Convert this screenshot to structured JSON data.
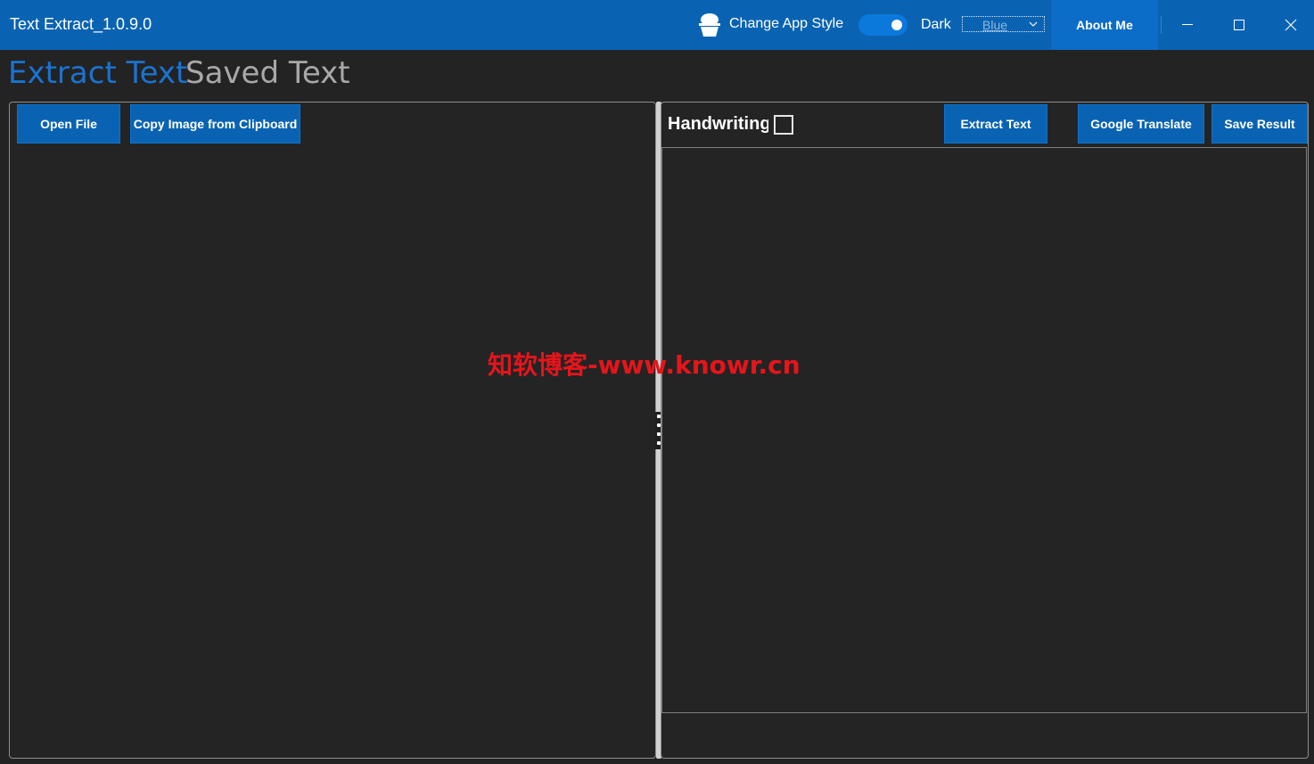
{
  "window": {
    "title": "Text Extract_1.0.9.0"
  },
  "header": {
    "style_label": "Change App Style",
    "theme_toggle": {
      "label": "Dark",
      "on": true
    },
    "color_select": {
      "value": "Blue"
    },
    "about_label": "About Me"
  },
  "tabs": {
    "extract": "Extract Text",
    "saved": "Saved Text",
    "active": "extract"
  },
  "left_panel": {
    "open_file_label": "Open File",
    "clipboard_label": "Copy Image from Clipboard"
  },
  "right_panel": {
    "handwriting_label": "Handwriting",
    "handwriting_checked": false,
    "extract_label": "Extract Text",
    "translate_label": "Google Translate",
    "save_label": "Save Result"
  },
  "watermark": "知软博客-www.knowr.cn",
  "colors": {
    "accent": "#0a63b2",
    "tab_active": "#1a73d1",
    "background": "#232323",
    "watermark": "#e5151b"
  },
  "icons": [
    "cupcake-icon",
    "chevron-down-icon",
    "minimize-icon",
    "maximize-icon",
    "close-icon",
    "splitter-grip-icon"
  ]
}
